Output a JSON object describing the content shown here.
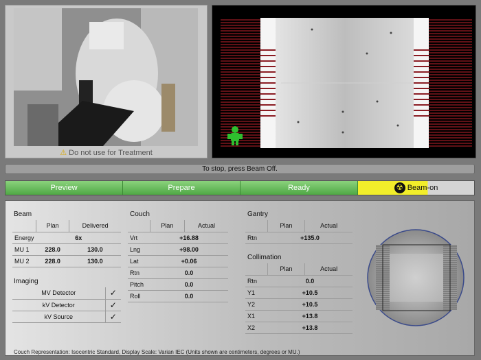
{
  "camera": {
    "warning": "Do not use for Treatment"
  },
  "status": {
    "message": "To stop, press Beam Off."
  },
  "workflow": {
    "steps": [
      "Preview",
      "Prepare",
      "Ready",
      "Beam-on"
    ]
  },
  "beam": {
    "title": "Beam",
    "headers": [
      "Plan",
      "Delivered"
    ],
    "energy_label": "Energy",
    "energy_value": "6x",
    "rows": [
      {
        "label": "MU 1",
        "plan": "228.0",
        "delivered": "130.0"
      },
      {
        "label": "MU 2",
        "plan": "228.0",
        "delivered": "130.0"
      }
    ]
  },
  "imaging": {
    "title": "Imaging",
    "items": [
      {
        "label": "MV Detector",
        "check": "✓"
      },
      {
        "label": "kV Detector",
        "check": "✓"
      },
      {
        "label": "kV Source",
        "check": "✓"
      }
    ]
  },
  "couch": {
    "title": "Couch",
    "headers": [
      "Plan",
      "Actual"
    ],
    "rows": [
      {
        "label": "Vrt",
        "value": "+16.88"
      },
      {
        "label": "Lng",
        "value": "+98.00"
      },
      {
        "label": "Lat",
        "value": "+0.06"
      },
      {
        "label": "Rtn",
        "value": "0.0"
      },
      {
        "label": "Pitch",
        "value": "0.0"
      },
      {
        "label": "Roll",
        "value": "0.0"
      }
    ]
  },
  "gantry": {
    "title": "Gantry",
    "headers": [
      "Plan",
      "Actual"
    ],
    "rows": [
      {
        "label": "Rtn",
        "value": "+135.0"
      }
    ]
  },
  "collimation": {
    "title": "Collimation",
    "headers": [
      "Plan",
      "Actual"
    ],
    "rows": [
      {
        "label": "Rtn",
        "value": "0.0"
      },
      {
        "label": "Y1",
        "value": "+10.5"
      },
      {
        "label": "Y2",
        "value": "+10.5"
      },
      {
        "label": "X1",
        "value": "+13.8"
      },
      {
        "label": "X2",
        "value": "+13.8"
      }
    ]
  },
  "footnote": "Couch Representation: Isocentric Standard, Display Scale: Varian IEC (Units shown are centimeters, degrees or MU.)",
  "colors": {
    "step_done": "#5cb84f",
    "step_active": "#f2ee2a",
    "leaf_red": "#c2222b"
  }
}
